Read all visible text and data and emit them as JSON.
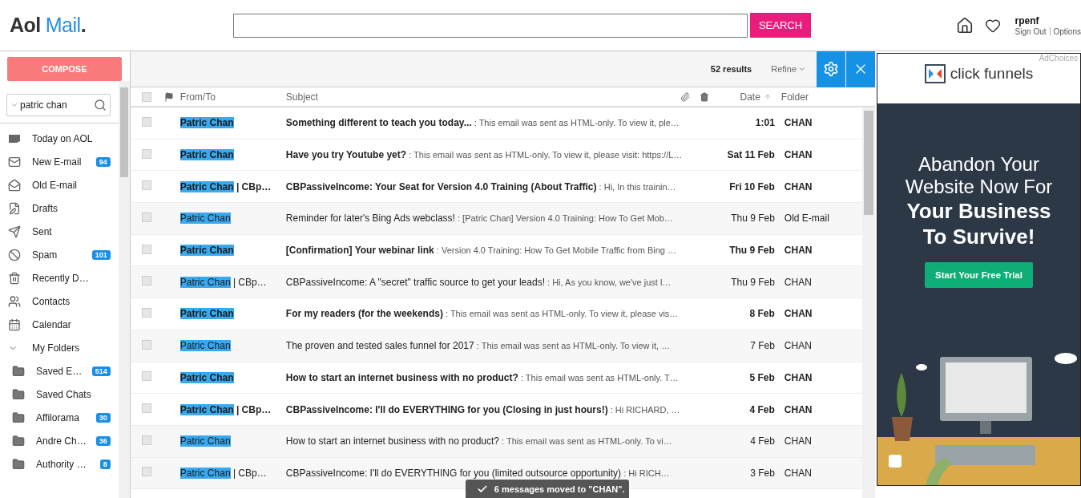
{
  "logo": {
    "brand": "Aol",
    "product": "Mail",
    "mark": "."
  },
  "search": {
    "button": "SEARCH"
  },
  "user": {
    "name": "rpenf",
    "sign_out": "Sign Out",
    "options": "Options"
  },
  "compose": "COMPOSE",
  "filter": {
    "value": "patric chan"
  },
  "nav": [
    {
      "label": "Today on AOL",
      "selected": false
    },
    {
      "label": "New E-mail",
      "badge": "94",
      "selected": false
    },
    {
      "label": "Old E-mail",
      "selected": false
    },
    {
      "label": "Drafts",
      "selected": false
    },
    {
      "label": "Sent",
      "selected": false
    },
    {
      "label": "Spam",
      "badge": "101",
      "selected": false
    },
    {
      "label": "Recently D…",
      "selected": false
    },
    {
      "label": "Contacts",
      "selected": false
    },
    {
      "label": "Calendar",
      "selected": false
    },
    {
      "label": "My Folders",
      "kind": "group",
      "expanded": true,
      "selected": false,
      "children": [
        {
          "label": "Saved E…",
          "badge": "514",
          "selected": false
        },
        {
          "label": "Saved Chats",
          "selected": false
        },
        {
          "label": "Affilorama",
          "badge": "30",
          "selected": false
        },
        {
          "label": "Andre Ch…",
          "badge": "36",
          "selected": false
        },
        {
          "label": "Authority …",
          "badge": "8",
          "selected": false
        }
      ]
    }
  ],
  "toolbar": {
    "results": "52 results",
    "refine": "Refine"
  },
  "table": {
    "select_all_checked": false,
    "columns": [
      "From/To",
      "Subject",
      "Date",
      "Folder"
    ],
    "rows": [
      {
        "checked": false,
        "unread": true,
        "from": "Patric Chan",
        "subject": "Something different to teach you today...",
        "preview": ": This email was sent as HTML-only. To view it, ple…",
        "date": "1:01",
        "folder": "CHAN"
      },
      {
        "checked": false,
        "unread": true,
        "from": "Patric Chan",
        "subject": "Have you try Youtube yet?",
        "preview": ": This email was sent as HTML-only. To view it, please visit: https://L…",
        "date": "Sat 11 Feb",
        "folder": "CHAN"
      },
      {
        "checked": false,
        "unread": true,
        "from": "Patric Chan",
        "from_extra": "| CBp…",
        "subject": "CBPassiveIncome: Your Seat for Version 4.0 Training (About Traffic)",
        "preview": ": Hi, In this trainin…",
        "date": "Fri 10 Feb",
        "folder": "CHAN"
      },
      {
        "checked": false,
        "unread": false,
        "from": "Patric Chan",
        "subject": "Reminder for later's Bing Ads webclass!",
        "preview": ": [Patric Chan] Version 4.0 Training: How To Get Mob…",
        "date": "Thu 9 Feb",
        "folder": "Old E-mail"
      },
      {
        "checked": false,
        "unread": true,
        "from": "Patric Chan",
        "subject": "[Confirmation] Your webinar link",
        "preview": ": Version 4.0 Training: How To Get Mobile Traffic from Bing …",
        "date": "Thu 9 Feb",
        "folder": "CHAN"
      },
      {
        "checked": false,
        "unread": false,
        "from": "Patric Chan",
        "from_extra": "| CBp…",
        "subject": "CBPassiveIncome: A \"secret\" traffic source to get your leads!",
        "preview": ": Hi, As you know, we've just l…",
        "date": "Thu 9 Feb",
        "folder": "CHAN"
      },
      {
        "checked": false,
        "unread": true,
        "from": "Patric Chan",
        "subject": "For my readers (for the weekends)",
        "preview": ": This email was sent as HTML-only. To view it, please vis…",
        "date": "8 Feb",
        "folder": "CHAN"
      },
      {
        "checked": false,
        "unread": false,
        "from": "Patric Chan",
        "subject": "The proven and tested sales funnel for 2017",
        "preview": ": This email was sent as HTML-only. To view it, …",
        "date": "7 Feb",
        "folder": "CHAN"
      },
      {
        "checked": false,
        "unread": true,
        "from": "Patric Chan",
        "subject": "How to start an internet business with no product?",
        "preview": ": This email was sent as HTML-only. T…",
        "date": "5 Feb",
        "folder": "CHAN"
      },
      {
        "checked": false,
        "unread": true,
        "from": "Patric Chan",
        "from_extra": "| CBp…",
        "subject": "CBPassiveIncome: I'll do EVERYTHING for you (Closing in just hours!)",
        "preview": ": Hi RICHARD, …",
        "date": "4 Feb",
        "folder": "CHAN"
      },
      {
        "checked": false,
        "unread": false,
        "from": "Patric Chan",
        "subject": "How to start an internet business with no product?",
        "preview": ": This email was sent as HTML-only. To vi…",
        "date": "4 Feb",
        "folder": "CHAN"
      },
      {
        "checked": false,
        "unread": false,
        "from": "Patric Chan",
        "from_extra": "| CBp…",
        "subject": "CBPassiveIncome: I'll do EVERYTHING for you (limited outsource opportunity)",
        "preview": ": Hi RICH…",
        "date": "3 Feb",
        "folder": "CHAN"
      }
    ]
  },
  "toast": "6 messages moved to \"CHAN\".",
  "ad": {
    "adchoices": "AdChoices",
    "brand": "click funnels",
    "headline_light": "Abandon Your Website Now For",
    "headline_bold": "Your Business To Survive!",
    "cta": "Start Your Free Trial"
  }
}
